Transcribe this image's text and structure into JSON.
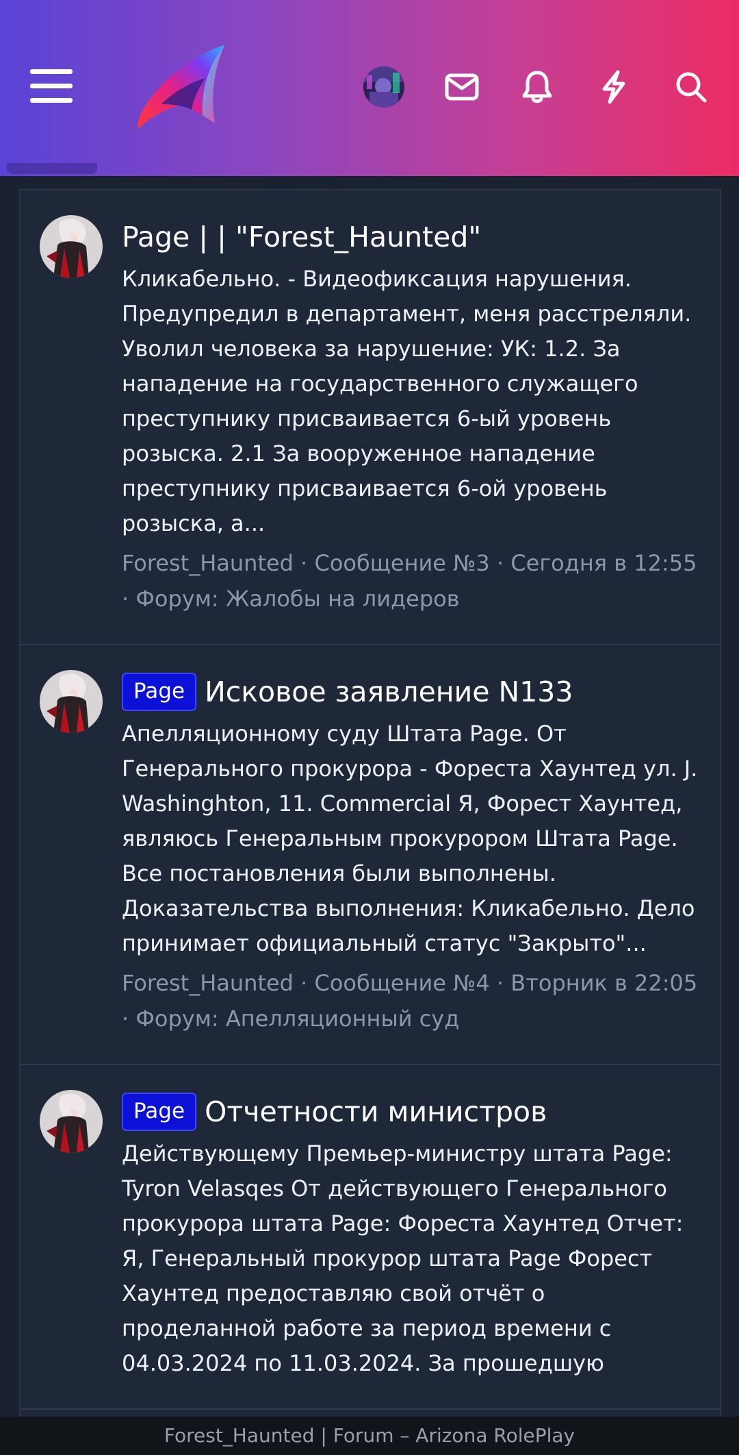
{
  "header": {
    "icons": [
      "hamburger-menu-icon",
      "arizona-logo",
      "user-avatar",
      "mail-icon",
      "bell-icon",
      "bolt-icon",
      "search-icon"
    ],
    "gradient": [
      "#5a43d6",
      "#ec2c63"
    ]
  },
  "posts": [
    {
      "badge": "",
      "title": "Page | | \"Forest_Haunted\"",
      "snippet": "Кликабельно. - Видеофиксация нарушения. Предупредил в департамент, меня расстреляли. Уволил человека за нарушение: УК: 1.2. За нападение на государственного служащего преступнику присваивается 6-ый уровень розыска. 2.1 За вооруженное нападение преступнику присваивается 6-ой уровень розыска, а...",
      "meta": "Forest_Haunted · Сообщение №3 · Сегодня в 12:55 · Форум: Жалобы на лидеров"
    },
    {
      "badge": "Page",
      "title": "Исковое заявление N133",
      "snippet": "Апелляционному суду Штата Page. От Генерального прокурора - Фореста Хаунтед ул. J. Washinghton, 11. Commercial Я, Форест Хаунтед, являюсь Генеральным прокурором Штата Page. Все постановления были выполнены. Доказательства выполнения: Кликабельно. Дело принимает официальный статус \"Закрыто\"...",
      "meta": "Forest_Haunted · Сообщение №4 · Вторник в 22:05 · Форум: Апелляционный суд"
    },
    {
      "badge": "Page",
      "title": "Отчетности министров",
      "snippet": "Действующему Премьер-министру штата Page: Tyron Velasqes От действующего Генерального прокурора штата Page: Фореста Хаунтед Отчет: Я, Генеральный прокурор штата Page Форест Хаунтед предоставляю свой отчёт о проделанной работе за период времени с 04.03.2024 по 11.03.2024. За прошедшую",
      "meta": ""
    }
  ],
  "footer": {
    "text": "Forest_Haunted | Forum – Arizona RolePlay"
  }
}
